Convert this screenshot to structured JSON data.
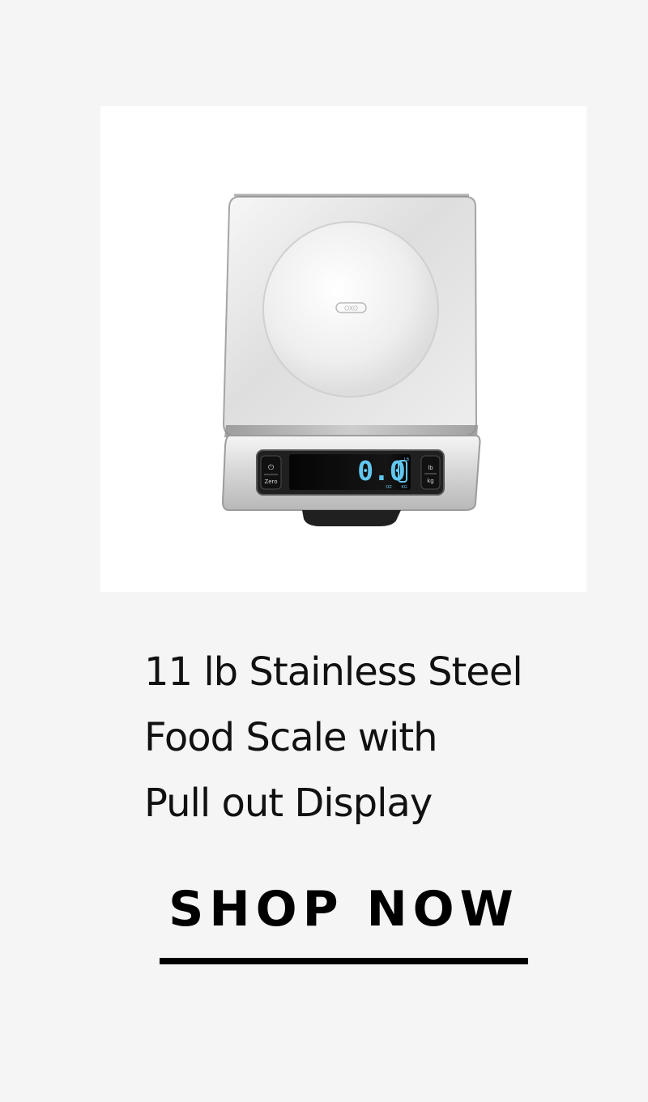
{
  "product": {
    "image_alt": "11 lb Stainless Steel Food Scale with Pull out Display",
    "title_lines": [
      "11 lb Stainless Steel",
      "Food Scale with",
      "Pull out Display"
    ],
    "scale": {
      "brand_mark": "OXO",
      "display_reading": "0.0",
      "display_units_top": "LB",
      "display_units_bottom_left": "OZ",
      "display_units_bottom_right": "KG",
      "left_button_label": "Zero",
      "right_button_top": "lb",
      "right_button_bottom": "kg"
    }
  },
  "cta": {
    "label": "SHOP NOW"
  },
  "colors": {
    "page_background": "#f5f5f5",
    "card_background": "#ffffff",
    "text": "#111111",
    "underline": "#000000"
  }
}
